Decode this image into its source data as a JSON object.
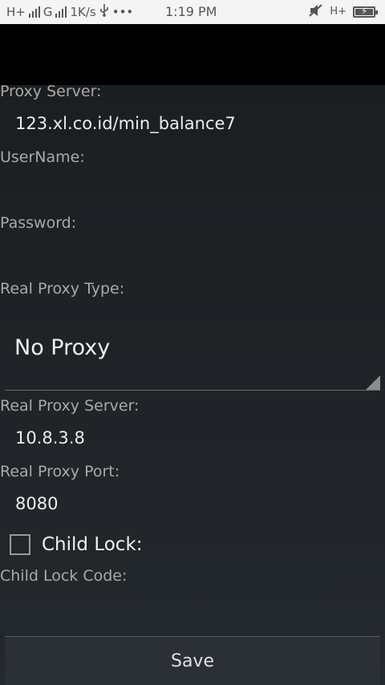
{
  "status_bar": {
    "network_1": "H+",
    "network_2": "G",
    "speed": "1K/s",
    "usb_icon": "usb-icon",
    "more": "•••",
    "time": "1:19 PM",
    "network_3": "H+"
  },
  "form": {
    "proxy_server_label": "Proxy Server:",
    "proxy_server_value": "123.xl.co.id/min_balance7",
    "username_label": "UserName:",
    "username_value": "",
    "password_label": "Password:",
    "password_value": "",
    "real_proxy_type_label": "Real Proxy Type:",
    "real_proxy_type_value": "No Proxy",
    "real_proxy_server_label": "Real Proxy Server:",
    "real_proxy_server_value": "10.8.3.8",
    "real_proxy_port_label": "Real Proxy Port:",
    "real_proxy_port_value": "8080",
    "child_lock_label": "Child Lock:",
    "child_lock_checked": false,
    "child_lock_code_label": "Child Lock Code:",
    "child_lock_code_value": ""
  },
  "save_button": {
    "label": "Save"
  }
}
